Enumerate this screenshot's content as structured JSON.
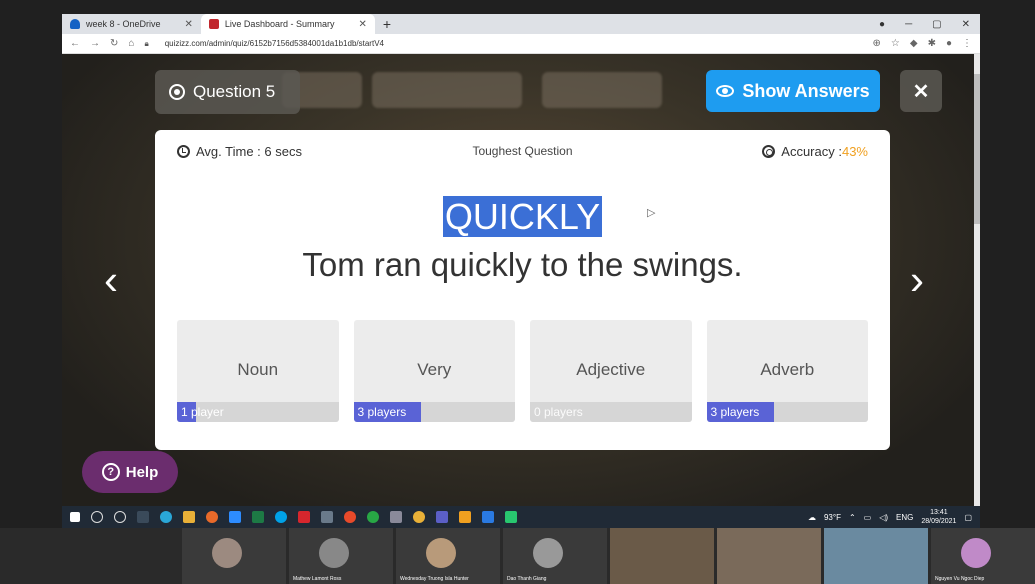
{
  "browser": {
    "tabs": [
      {
        "label": "week 8 - OneDrive",
        "icon": "onedrive-icon",
        "active": false
      },
      {
        "label": "Live Dashboard - Summary",
        "icon": "quizizz-icon",
        "active": true
      }
    ],
    "url": "quizizz.com/admin/quiz/6152b7156d5384001da1b1db/startV4"
  },
  "question": {
    "label": "Question 5",
    "show_answers_label": "Show Answers",
    "avg_time": "Avg. Time : 6 secs",
    "toughest": "Toughest Question",
    "accuracy_label": "Accuracy : ",
    "accuracy_value": "43%",
    "keyword": "QUICKLY",
    "sentence": "Tom ran quickly to the swings.",
    "options": [
      {
        "label": "Noun",
        "players": "1 player",
        "fraction": 0.12
      },
      {
        "label": "Very",
        "players": "3 players",
        "fraction": 0.42
      },
      {
        "label": "Adjective",
        "players": "0 players",
        "fraction": 0
      },
      {
        "label": "Adverb",
        "players": "3 players",
        "fraction": 0.42
      }
    ],
    "help_label": "Help"
  },
  "taskbar": {
    "weather": "93°F",
    "lang": "ENG",
    "time": "13:41",
    "date": "28/09/2021"
  },
  "meeting": {
    "participants": [
      {
        "name": ""
      },
      {
        "name": "Mathew Lamont Ross"
      },
      {
        "name": "Wednesday Truong Isla Hunter"
      },
      {
        "name": "Dao Thanh Giang"
      },
      {
        "name": ""
      },
      {
        "name": ""
      },
      {
        "name": ""
      },
      {
        "name": "Nguyen Vu Ngoc Diep"
      }
    ]
  },
  "colors": {
    "accent": "#1e9cf0",
    "bar_fill": "#5a63d6",
    "accuracy": "#f0a020",
    "help": "#6b2d6e"
  }
}
